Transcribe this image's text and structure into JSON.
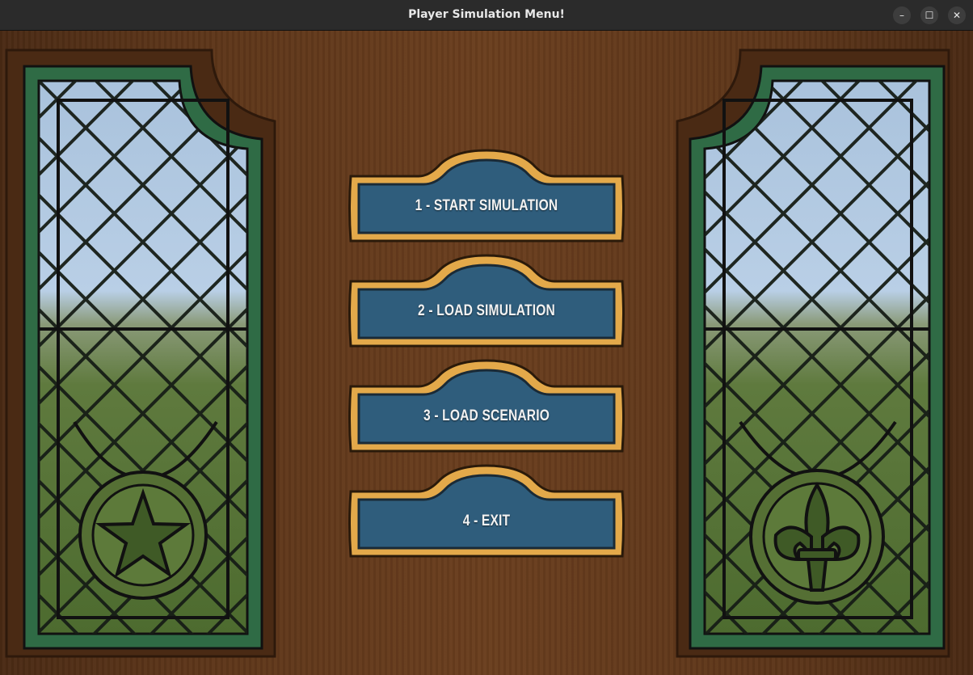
{
  "window": {
    "title": "Player Simulation Menu!",
    "controls": {
      "minimize": "–",
      "maximize": "☐",
      "close": "✕"
    }
  },
  "menu": {
    "items": [
      {
        "label": "1 - START SIMULATION"
      },
      {
        "label": "2 - LOAD SIMULATION"
      },
      {
        "label": "3 - LOAD SCENARIO"
      },
      {
        "label": "4 - EXIT"
      }
    ]
  },
  "decorations": {
    "left_window_emblem": "star-icon",
    "right_window_emblem": "fleur-de-lis-icon"
  },
  "colors": {
    "button_fill": "#2f5d7c",
    "button_border": "#e3a94a",
    "wood": "#5c3519",
    "lead_frame": "#1a2b1a",
    "glass_frame": "#2f6b45"
  }
}
